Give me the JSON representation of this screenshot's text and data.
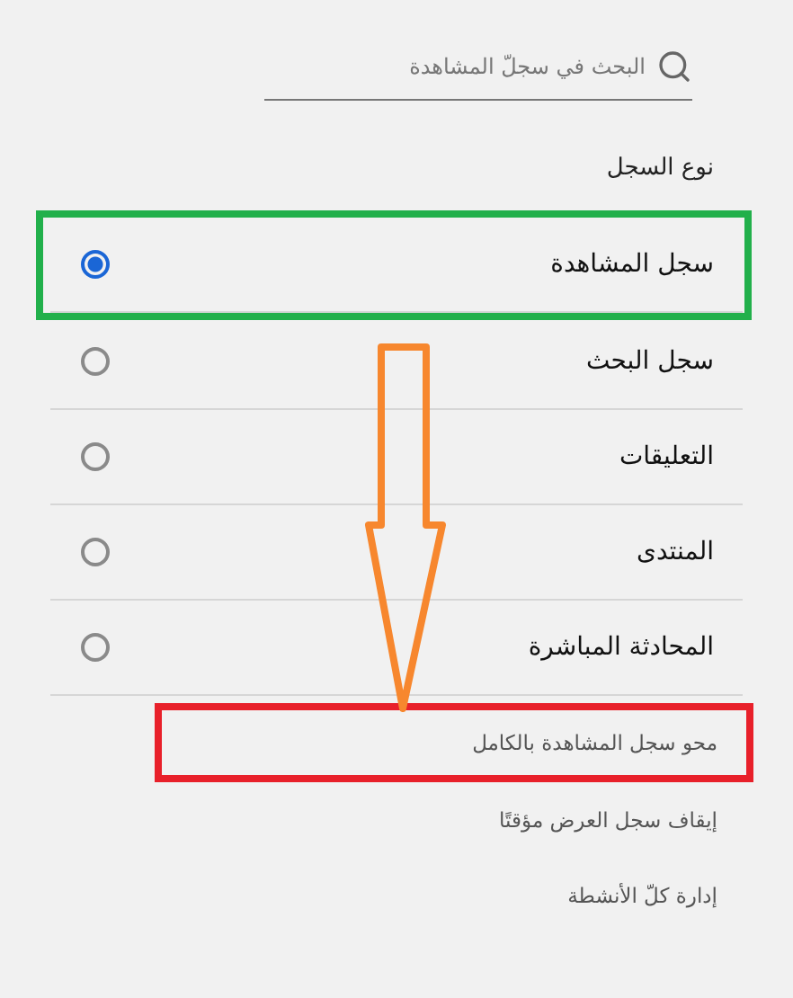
{
  "search": {
    "placeholder": "البحث في سجلّ المشاهدة"
  },
  "section_label": "نوع السجل",
  "history_types": [
    {
      "label": "سجل المشاهدة",
      "selected": true,
      "color": "#22b04b"
    },
    {
      "label": "سجل البحث",
      "selected": false
    },
    {
      "label": "التعليقات",
      "selected": false
    },
    {
      "label": "المنتدى",
      "selected": false
    },
    {
      "label": "المحادثة المباشرة",
      "selected": false
    }
  ],
  "actions": [
    {
      "label": "محو سجل المشاهدة بالكامل",
      "color": "#e8202a"
    },
    {
      "label": "إيقاف سجل العرض مؤقتًا"
    },
    {
      "label": "إدارة كلّ الأنشطة"
    }
  ],
  "arrow": {
    "color": "#f7872e"
  }
}
